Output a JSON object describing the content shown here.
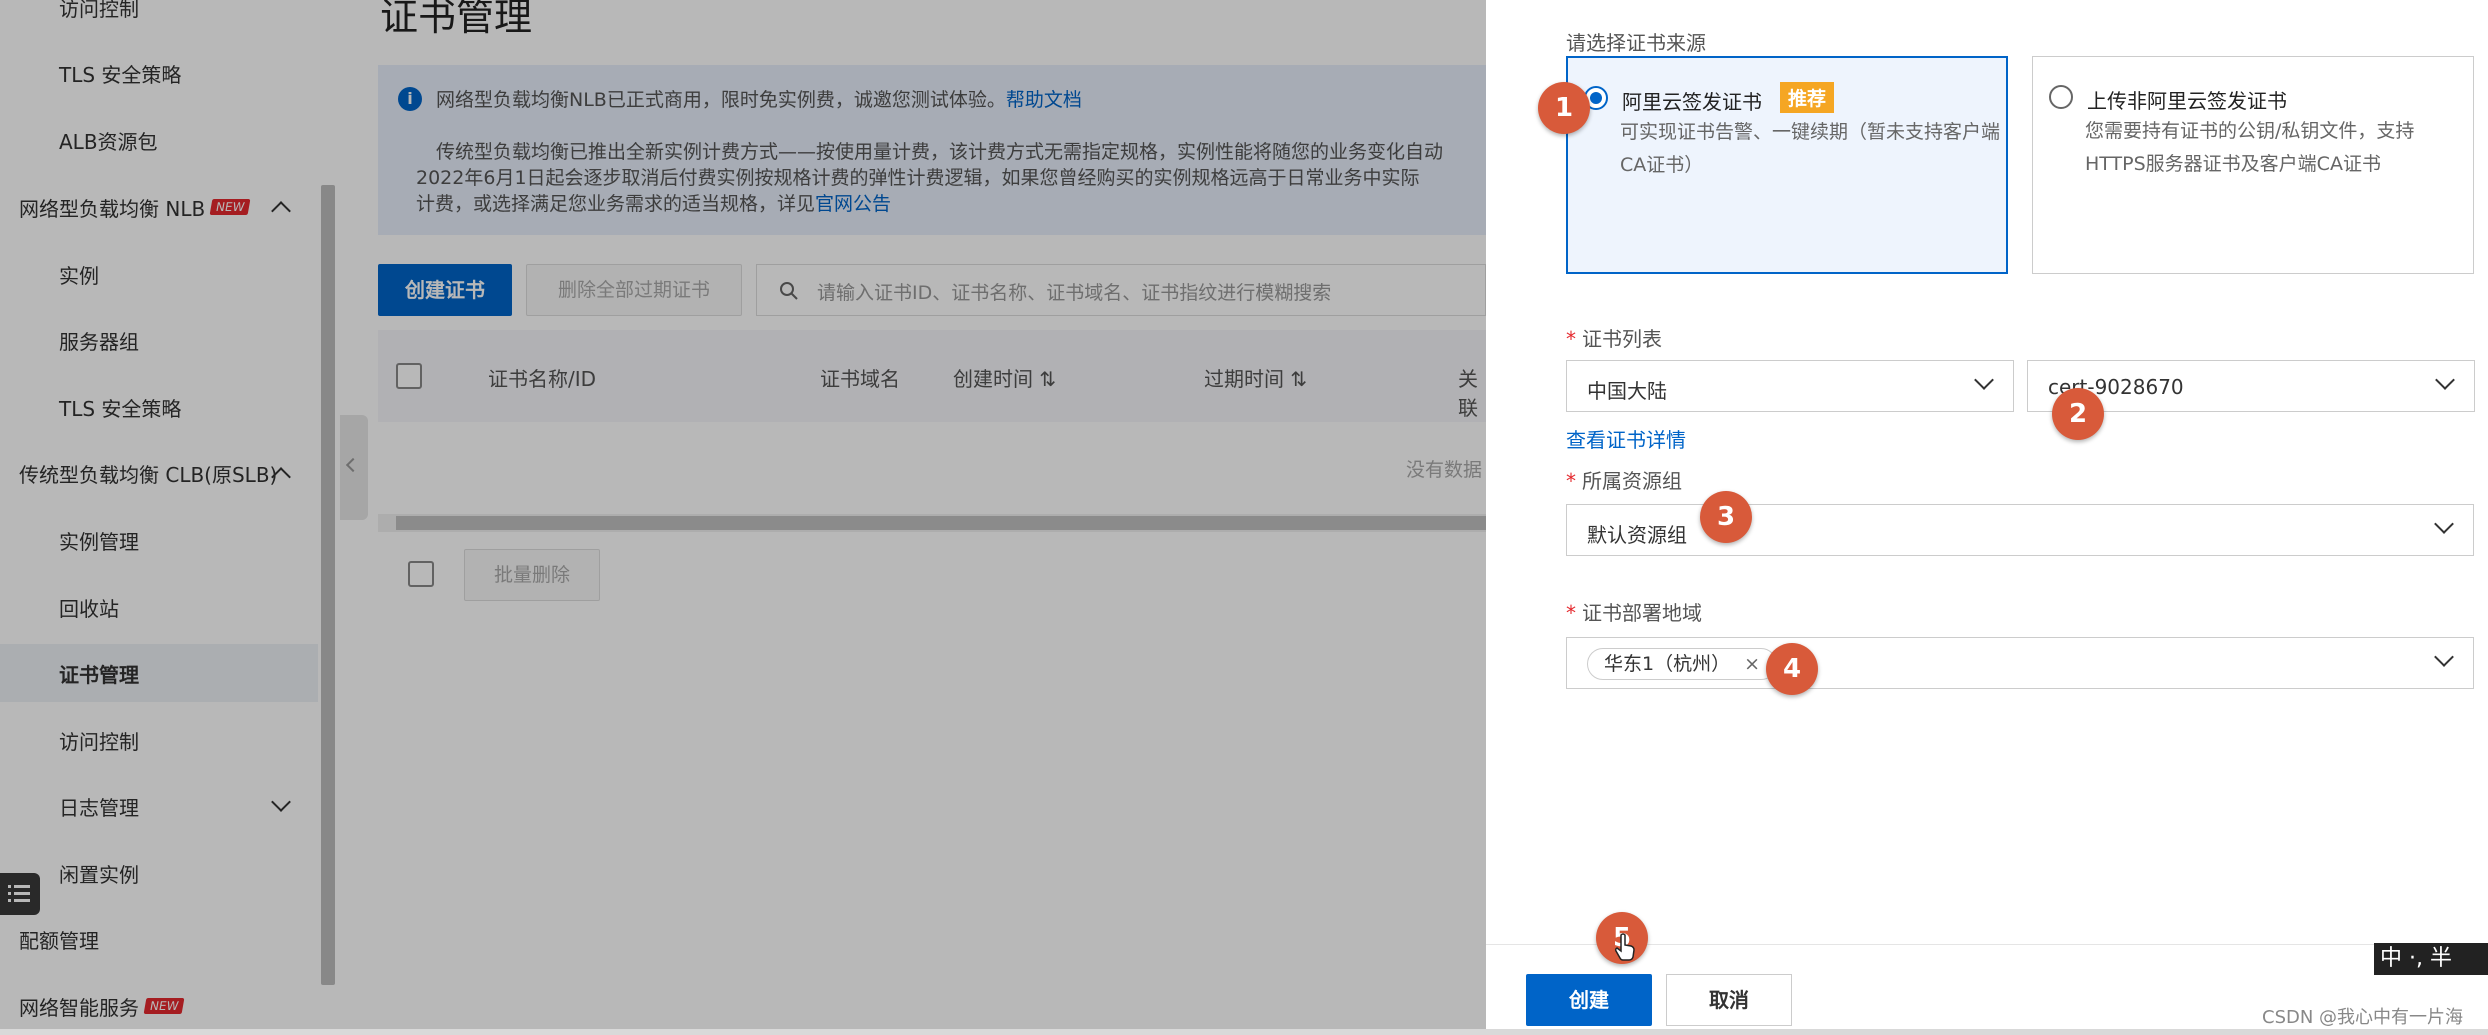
{
  "sidebar": {
    "items": [
      {
        "label": "访问控制"
      },
      {
        "label": "TLS 安全策略"
      },
      {
        "label": "ALB资源包"
      },
      {
        "label": "网络型负载均衡 NLB",
        "badge": "NEW"
      },
      {
        "label": "实例"
      },
      {
        "label": "服务器组"
      },
      {
        "label": "TLS 安全策略"
      },
      {
        "label": "传统型负载均衡 CLB(原SLB)"
      },
      {
        "label": "实例管理"
      },
      {
        "label": "回收站"
      },
      {
        "label": "证书管理"
      },
      {
        "label": "访问控制"
      },
      {
        "label": "日志管理"
      },
      {
        "label": "闲置实例"
      },
      {
        "label": "配额管理"
      },
      {
        "label": "网络智能服务",
        "badge": "NEW"
      }
    ]
  },
  "main": {
    "title": "证书管理",
    "notice": {
      "line1": "网络型负载均衡NLB已正式商用，限时免实例费，诚邀您测试体验。",
      "line1_link": "帮助文档",
      "line2": "传统型负载均衡已推出全新实例计费方式——按使用量计费，该计费方式无需指定规格，实例性能将随您的业务变化自动",
      "line3": "2022年6月1日起会逐步取消后付费实例按规格计费的弹性计费逻辑，如果您曾经购买的实例规格远高于日常业务中实际",
      "line4": "计费，或选择满足您业务需求的适当规格，详见",
      "line4_link": "官网公告"
    },
    "create_button": "创建证书",
    "delete_expired_button": "删除全部过期证书",
    "search_placeholder": "请输入证书ID、证书名称、证书域名、证书指纹进行模糊搜索",
    "table": {
      "columns": [
        "证书名称/ID",
        "证书域名",
        "创建时间",
        "过期时间",
        "关联"
      ],
      "empty_text": "没有数据"
    },
    "batch_delete_button": "批量删除"
  },
  "drawer": {
    "source_label": "请选择证书来源",
    "option_aliyun": {
      "title": "阿里云签发证书",
      "badge": "推荐",
      "desc": "可实现证书告警、一键续期（暂未支持客户端CA证书）"
    },
    "option_upload": {
      "title": "上传非阿里云签发证书",
      "desc": "您需要持有证书的公钥/私钥文件，支持HTTPS服务器证书及客户端CA证书"
    },
    "cert_list_label": "证书列表",
    "region_value": "中国大陆",
    "cert_value": "cert-9028670",
    "view_cert_link": "查看证书详情",
    "resource_group_label": "所属资源组",
    "resource_group_value": "默认资源组",
    "deploy_region_label": "证书部署地域",
    "deploy_region_tag": "华东1（杭州）",
    "create_button": "创建",
    "cancel_button": "取消"
  },
  "steps": [
    "1",
    "2",
    "3",
    "4",
    "5"
  ],
  "ime": "中 ·, 半",
  "watermark": "CSDN @我心中有一片海",
  "colors": {
    "accent": "#0064c8",
    "step": "#d85a3a",
    "recommend": "#f5a623",
    "new_badge": "#e5292e"
  }
}
